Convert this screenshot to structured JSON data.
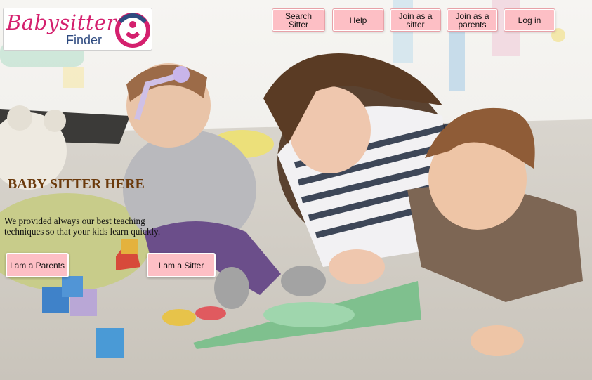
{
  "logo": {
    "word": "Babysitter",
    "sub": "Finder"
  },
  "nav": {
    "items": [
      {
        "label": "Search Sitter"
      },
      {
        "label": "Help"
      },
      {
        "label": "Join as a sitter"
      },
      {
        "label": "Join as a parents"
      },
      {
        "label": "Log in"
      }
    ]
  },
  "hero": {
    "title": "BABY SITTER HERE",
    "description": "We provided always our best teaching techniques so that your kids learn quickly.",
    "parent_button": "I am a Parents",
    "sitter_button": "I am a Sitter"
  },
  "colors": {
    "button_bg": "#fdbfc5",
    "title_brown": "#6b3a0c",
    "brand_pink": "#d4206e",
    "brand_blue": "#2f4b80"
  },
  "icons": {
    "logo_mark": "babysitter-logo-icon"
  }
}
